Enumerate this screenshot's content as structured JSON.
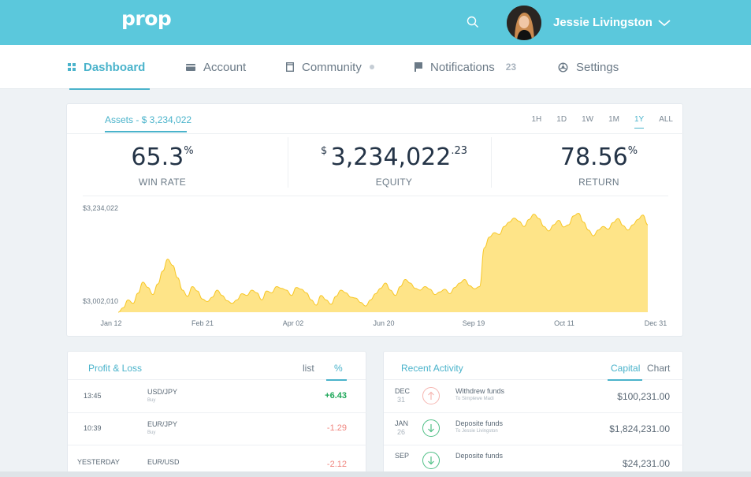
{
  "header": {
    "logo": "prop",
    "user_name": "Jessie Livingston"
  },
  "nav": {
    "items": [
      {
        "label": "Dashboard",
        "icon": "dashboard-icon",
        "active": true
      },
      {
        "label": "Account",
        "icon": "wallet-icon"
      },
      {
        "label": "Community",
        "icon": "document-icon"
      },
      {
        "label": "Notifications",
        "icon": "flag-icon",
        "count": "23"
      },
      {
        "label": "Settings",
        "icon": "gear-icon"
      }
    ]
  },
  "assets": {
    "title": "Assets - $ 3,234,022",
    "ranges": [
      "1H",
      "1D",
      "1W",
      "1M",
      "1Y",
      "ALL"
    ],
    "active_range": "1Y",
    "stats": {
      "win_rate": {
        "value": "65.3",
        "unit": "%",
        "label": "WIN RATE"
      },
      "equity": {
        "currency": "$",
        "value": "3,234,022",
        "cents": ".23",
        "label": "EQUITY"
      },
      "return": {
        "value": "78.56",
        "unit": "%",
        "label": "RETURN"
      }
    }
  },
  "chart_data": {
    "type": "area",
    "y_labels": [
      "$3,234,022",
      "$3,002,010"
    ],
    "x_labels": [
      "Jan 12",
      "Feb 21",
      "Apr 02",
      "Jun 20",
      "Sep 19",
      "Oct 11",
      "Dec 31"
    ],
    "ylim": [
      3002010,
      3234022
    ],
    "values": [
      3002010,
      3012000,
      3030000,
      3022000,
      3045000,
      3070000,
      3058000,
      3042000,
      3066000,
      3095000,
      3122000,
      3108000,
      3080000,
      3052000,
      3038000,
      3060000,
      3050000,
      3032000,
      3026000,
      3036000,
      3052000,
      3040000,
      3028000,
      3022000,
      3030000,
      3044000,
      3040000,
      3052000,
      3046000,
      3030000,
      3050000,
      3046000,
      3060000,
      3056000,
      3052000,
      3040000,
      3058000,
      3054000,
      3046000,
      3030000,
      3018000,
      3040000,
      3030000,
      3020000,
      3038000,
      3052000,
      3046000,
      3036000,
      3034000,
      3024000,
      3016000,
      3030000,
      3044000,
      3056000,
      3068000,
      3052000,
      3040000,
      3060000,
      3076000,
      3068000,
      3056000,
      3052000,
      3060000,
      3054000,
      3042000,
      3048000,
      3054000,
      3044000,
      3058000,
      3068000,
      3076000,
      3062000,
      3055000,
      3060000,
      3148000,
      3172000,
      3182000,
      3178000,
      3196000,
      3206000,
      3215000,
      3208000,
      3196000,
      3212000,
      3224000,
      3214000,
      3196000,
      3186000,
      3200000,
      3210000,
      3195000,
      3200000,
      3220000,
      3226000,
      3206000,
      3188000,
      3175000,
      3188000,
      3196000,
      3190000,
      3205000,
      3214000,
      3198000,
      3188000,
      3200000,
      3212000,
      3222000,
      3200000
    ]
  },
  "profit_loss": {
    "title": "Profit & Loss",
    "tab_list": "list",
    "tab_pct": "%",
    "rows": [
      {
        "time": "13:45",
        "pair": "USD/JPY",
        "side": "Buy",
        "change": "+6.43",
        "positive": true
      },
      {
        "time": "10:39",
        "pair": "EUR/JPY",
        "side": "Buy",
        "change": "-1.29",
        "positive": false
      },
      {
        "time": "YESTERDAY",
        "pair": "EUR/USD",
        "side": "",
        "change": "-2.12",
        "positive": false
      }
    ]
  },
  "recent_activity": {
    "title": "Recent Activity",
    "tab_capital": "Capital",
    "tab_chart": "Chart",
    "rows": [
      {
        "month": "DEC",
        "day": "31",
        "direction": "up",
        "desc": "Withdrew funds",
        "sub": "To Simplewe Madi",
        "amount": "$100,231.00"
      },
      {
        "month": "JAN",
        "day": "26",
        "direction": "down",
        "desc": "Deposite funds",
        "sub": "To Jessie Livingston",
        "amount": "$1,824,231.00"
      },
      {
        "month": "SEP",
        "day": "",
        "direction": "down",
        "desc": "Deposite funds",
        "sub": "",
        "amount": "$24,231.00"
      }
    ]
  },
  "colors": {
    "header": "#5bc8dc",
    "accent": "#4ab3cb",
    "area_fill": "#fee488",
    "area_stroke": "#f7c727",
    "positive": "#1fa85a",
    "negative": "#f0857e"
  }
}
